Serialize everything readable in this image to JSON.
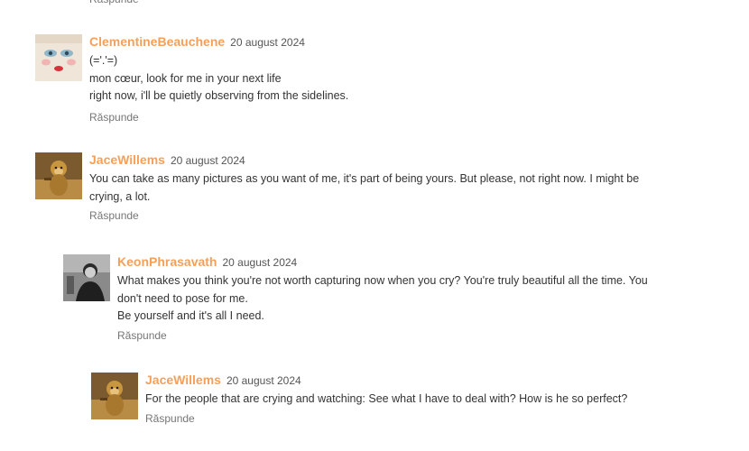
{
  "reply_label": "Răspunde",
  "colors": {
    "author": "#f5a05a",
    "text": "#333333",
    "date": "#555555",
    "reply": "#767676"
  },
  "comments": [
    {
      "author": "ClementineBeauchene",
      "date": "20 august 2024",
      "avatar": "doll-face-avatar",
      "lines": [
        "(='.'=)",
        "mon cœur, look for me in your next life",
        "right now, i'll be quietly observing from the sidelines."
      ]
    },
    {
      "author": "JaceWillems",
      "date": "20 august 2024",
      "avatar": "monkey-avatar",
      "lines": [
        "You can take as many pictures as you want of me, it's part of being yours. But please, not right now. I might be crying, a lot."
      ]
    },
    {
      "author": "KeonPhrasavath",
      "date": "20 august 2024",
      "avatar": "bw-portrait-avatar",
      "lines": [
        "What makes you think you're not worth capturing now when you cry? You're truly beautiful all the time. You don't need to pose for me.",
        "Be yourself and it's all I need."
      ]
    },
    {
      "author": "JaceWillems",
      "date": "20 august 2024",
      "avatar": "monkey-avatar",
      "lines": [
        "For the people that are crying and watching: See what I have to deal with? How is he so perfect?"
      ]
    }
  ]
}
